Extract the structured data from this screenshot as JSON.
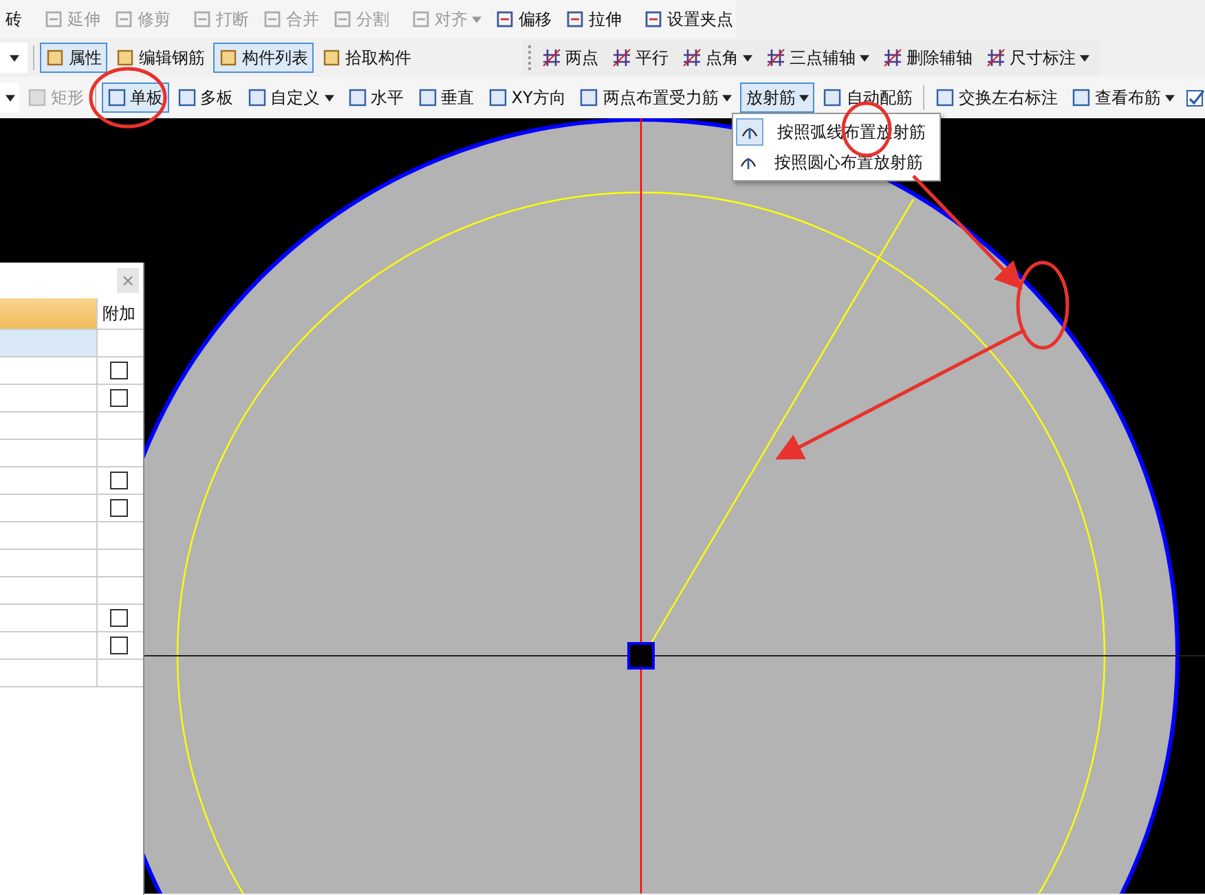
{
  "toolbar_1": [
    {
      "label": "砖",
      "disabled": false,
      "selected": false,
      "dropdown": false,
      "icon": false,
      "sep_before": false
    },
    {
      "label": "延伸",
      "disabled": true,
      "selected": false,
      "dropdown": false,
      "icon": true,
      "sep_before": true
    },
    {
      "label": "修剪",
      "disabled": true,
      "selected": false,
      "dropdown": false,
      "icon": true,
      "sep_before": false
    },
    {
      "label": "打断",
      "disabled": true,
      "selected": false,
      "dropdown": false,
      "icon": true,
      "sep_before": true
    },
    {
      "label": "合并",
      "disabled": true,
      "selected": false,
      "dropdown": false,
      "icon": true,
      "sep_before": false
    },
    {
      "label": "分割",
      "disabled": true,
      "selected": false,
      "dropdown": false,
      "icon": true,
      "sep_before": false
    },
    {
      "label": "对齐",
      "disabled": true,
      "selected": false,
      "dropdown": true,
      "icon": true,
      "sep_before": true
    },
    {
      "label": "偏移",
      "disabled": false,
      "selected": false,
      "dropdown": false,
      "icon": true,
      "sep_before": false
    },
    {
      "label": "拉伸",
      "disabled": false,
      "selected": false,
      "dropdown": false,
      "icon": true,
      "sep_before": false
    },
    {
      "label": "设置夹点",
      "disabled": false,
      "selected": false,
      "dropdown": false,
      "icon": true,
      "sep_before": true
    }
  ],
  "toolbar_2": [
    {
      "label": "属性",
      "disabled": false,
      "selected": true,
      "dropdown": false,
      "icon": true,
      "sep_before": true
    },
    {
      "label": "编辑钢筋",
      "disabled": false,
      "selected": false,
      "dropdown": false,
      "icon": true,
      "sep_before": false
    },
    {
      "label": "构件列表",
      "disabled": false,
      "selected": true,
      "dropdown": false,
      "icon": true,
      "sep_before": false
    },
    {
      "label": "拾取构件",
      "disabled": false,
      "selected": false,
      "dropdown": false,
      "icon": true,
      "sep_before": false
    }
  ],
  "toolbar_axis": [
    {
      "label": "两点",
      "disabled": false,
      "selected": false,
      "dropdown": false,
      "icon": true
    },
    {
      "label": "平行",
      "disabled": false,
      "selected": false,
      "dropdown": false,
      "icon": true
    },
    {
      "label": "点角",
      "disabled": false,
      "selected": false,
      "dropdown": true,
      "icon": true
    },
    {
      "label": "三点辅轴",
      "disabled": false,
      "selected": false,
      "dropdown": true,
      "icon": true
    },
    {
      "label": "删除辅轴",
      "disabled": false,
      "selected": false,
      "dropdown": false,
      "icon": true
    },
    {
      "label": "尺寸标注",
      "disabled": false,
      "selected": false,
      "dropdown": true,
      "icon": true
    }
  ],
  "toolbar_3": [
    {
      "label": "矩形",
      "disabled": true,
      "selected": false,
      "dropdown": false,
      "icon": true,
      "sep_before": false
    },
    {
      "label": "单板",
      "disabled": false,
      "selected": true,
      "dropdown": false,
      "icon": true,
      "sep_before": true
    },
    {
      "label": "多板",
      "disabled": false,
      "selected": false,
      "dropdown": false,
      "icon": true,
      "sep_before": false
    },
    {
      "label": "自定义",
      "disabled": false,
      "selected": false,
      "dropdown": true,
      "icon": true,
      "sep_before": false
    },
    {
      "label": "水平",
      "disabled": false,
      "selected": false,
      "dropdown": false,
      "icon": true,
      "sep_before": false
    },
    {
      "label": "垂直",
      "disabled": false,
      "selected": false,
      "dropdown": false,
      "icon": true,
      "sep_before": false
    },
    {
      "label": "XY方向",
      "disabled": false,
      "selected": false,
      "dropdown": false,
      "icon": true,
      "sep_before": false
    },
    {
      "label": "两点布置受力筋",
      "disabled": false,
      "selected": false,
      "dropdown": true,
      "icon": true,
      "sep_before": false
    },
    {
      "label": "放射筋",
      "disabled": false,
      "selected": true,
      "dropdown": true,
      "icon": false,
      "sep_before": false
    },
    {
      "label": "自动配筋",
      "disabled": false,
      "selected": false,
      "dropdown": false,
      "icon": true,
      "sep_before": false
    },
    {
      "label": "交换左右标注",
      "disabled": false,
      "selected": false,
      "dropdown": false,
      "icon": true,
      "sep_before": true
    },
    {
      "label": "查看布筋",
      "disabled": false,
      "selected": false,
      "dropdown": true,
      "icon": true,
      "sep_before": false
    }
  ],
  "menu": [
    {
      "label": "按照弧线布置放射筋",
      "selected": true
    },
    {
      "label": "按照圆心布置放射筋",
      "selected": false
    }
  ],
  "panel": {
    "close": "×",
    "columns": [
      "附加"
    ],
    "rows": [
      {
        "kind": "plain",
        "selected": true
      },
      {
        "kind": "checkbox",
        "checked": false,
        "selected": false
      },
      {
        "kind": "checkbox",
        "checked": false,
        "selected": false
      },
      {
        "kind": "plain",
        "selected": false
      },
      {
        "kind": "plain",
        "selected": false
      },
      {
        "kind": "checkbox",
        "checked": false,
        "selected": false
      },
      {
        "kind": "checkbox",
        "checked": false,
        "selected": false
      },
      {
        "kind": "plain",
        "selected": false
      },
      {
        "kind": "plain",
        "selected": false
      },
      {
        "kind": "plain",
        "selected": false
      },
      {
        "kind": "checkbox",
        "checked": false,
        "selected": false
      },
      {
        "kind": "checkbox",
        "checked": false,
        "selected": false
      },
      {
        "kind": "plain",
        "selected": false
      }
    ]
  }
}
